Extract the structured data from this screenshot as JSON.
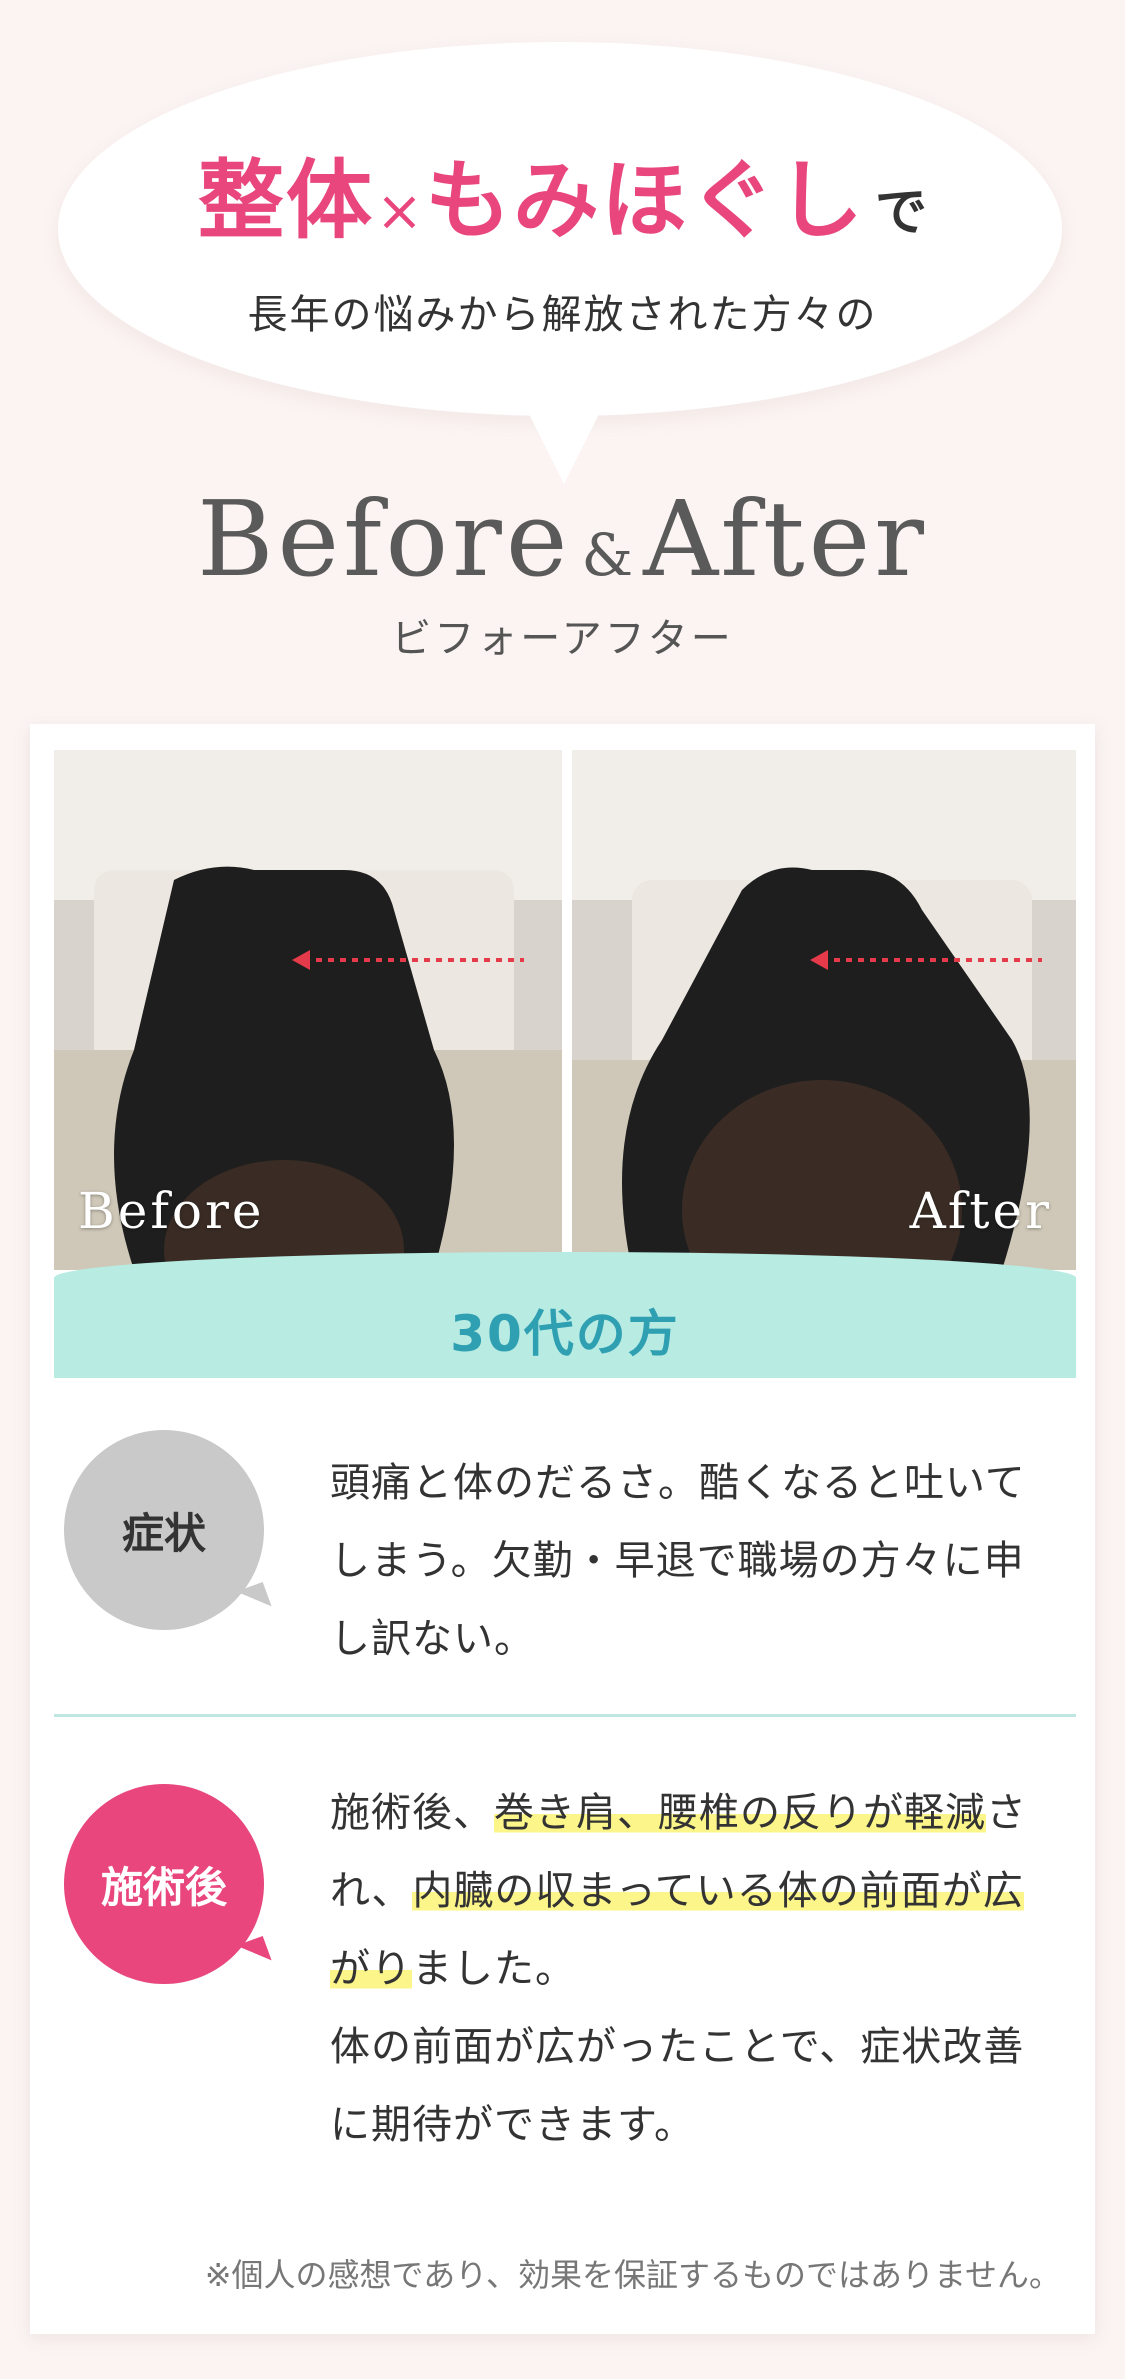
{
  "header": {
    "headline_part1": "整体",
    "headline_times": "×",
    "headline_part2": "もみほぐし",
    "headline_suffix": "で",
    "subline": "長年の悩みから解放された方々の"
  },
  "title": {
    "before": "Before",
    "amp": "&",
    "after": "After",
    "kana": "ビフォーアフター"
  },
  "photos": {
    "before_label": "Before",
    "after_label": "After"
  },
  "age_band": "30代の方",
  "symptom": {
    "tag": "症状",
    "text": "頭痛と体のだるさ。酷くなると吐いてしまう。欠勤・早退で職場の方々に申し訳ない。"
  },
  "after_treatment": {
    "tag": "施術後",
    "text_1": "施術後、",
    "highlight_1": "巻き肩、腰椎の反りが軽減",
    "text_2": "され、",
    "highlight_2": "内臓の収まっている体の前面が広がり",
    "text_3": "ました。",
    "text_4": "体の前面が広がったことで、症状改善に期待ができます。"
  },
  "disclaimer": "※個人の感想であり、効果を保証するものではありません。",
  "colors": {
    "accent_pink": "#e8467d",
    "teal_text": "#2f9fb2",
    "teal_band": "#b8ebe2",
    "highlight_yellow": "#fbf58a",
    "background": "#fbf4f2"
  }
}
